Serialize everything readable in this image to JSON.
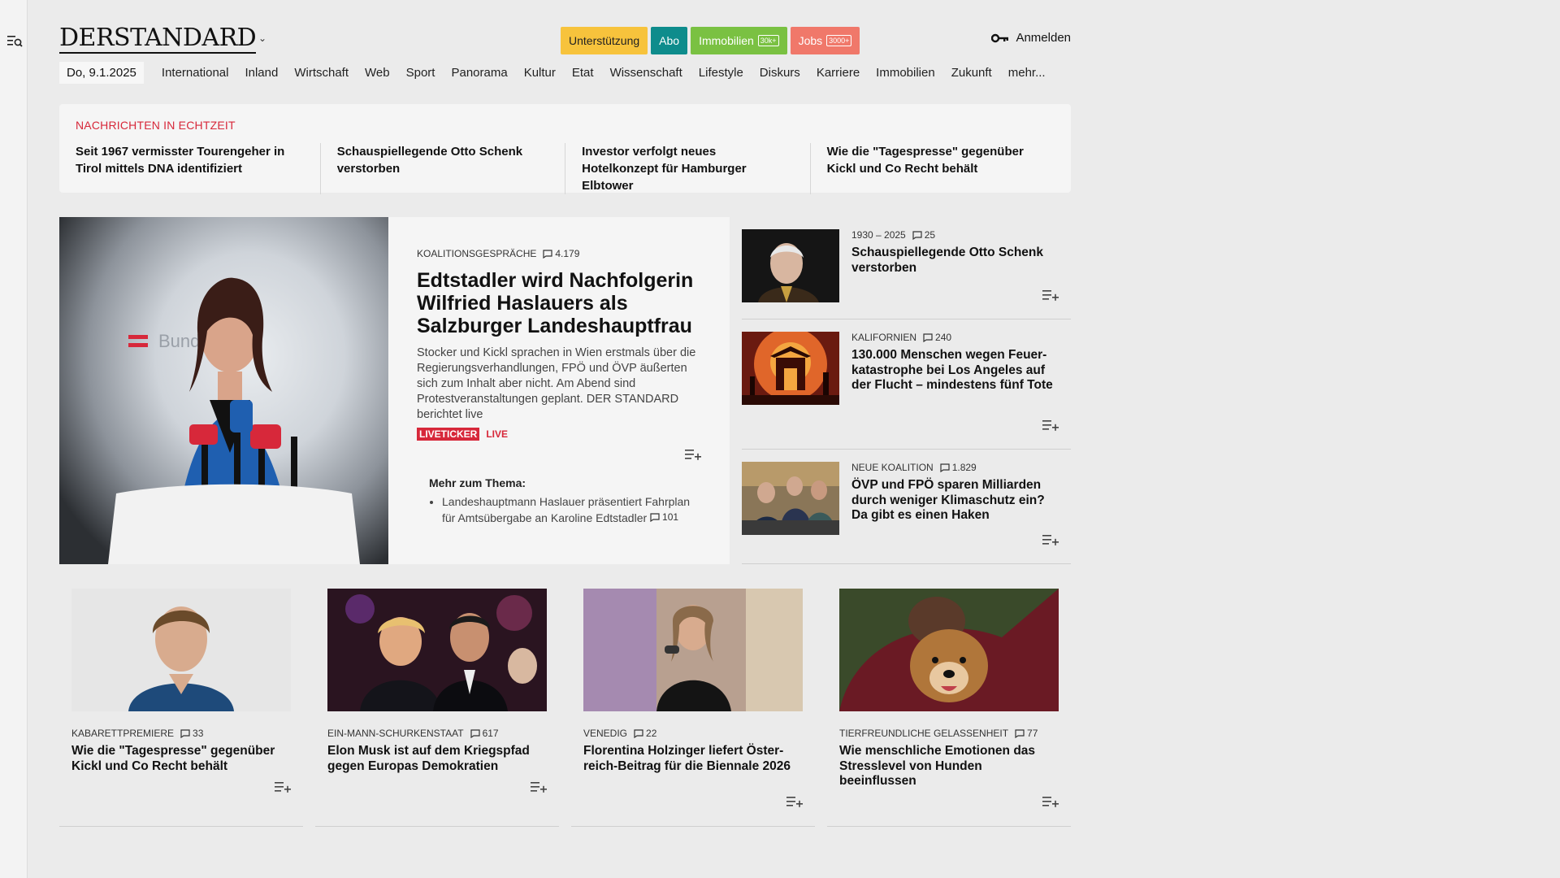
{
  "header": {
    "logo": "DERSTANDARD",
    "pills": [
      {
        "label": "Unterstützung",
        "badge": ""
      },
      {
        "label": "Abo",
        "badge": ""
      },
      {
        "label": "Immobilien",
        "badge": "30k+"
      },
      {
        "label": "Jobs",
        "badge": "3000+"
      }
    ],
    "login": "Anmelden"
  },
  "nav": {
    "date": "Do, 9.1.2025",
    "items": [
      "International",
      "Inland",
      "Wirtschaft",
      "Web",
      "Sport",
      "Panorama",
      "Kultur",
      "Etat",
      "Wissenschaft",
      "Lifestyle",
      "Diskurs",
      "Karriere",
      "Immobilien",
      "Zukunft",
      "mehr..."
    ]
  },
  "ticker": {
    "title": "Nachrichten in Echtzeit",
    "items": [
      "Seit 1967 vermisster Tourengeher in Tirol mittels DNA identifiziert",
      "Schauspiellegende Otto Schenk verstorben",
      "Investor verfolgt neues Hotelkonzept für Hamburger Elbtower",
      "Wie die \"Tagespresse\" gegenüber Kickl und Co Recht behält"
    ]
  },
  "lead": {
    "kicker": "Koalitionsgespräche",
    "comments": "4.179",
    "title": "Edtstadler wird Nachfolgerin Wilfried Haslauers als Salzburger Landeshauptfrau",
    "teaser": "Stocker und Kickl sprachen in Wien erstmals über die Regierungsverhandlungen, FPÖ und ÖVP äußerten sich zum Inhalt aber nicht. Am Abend sind Protestveranstaltungen geplant. DER STANDARD berichtet live",
    "live_tag": "LIVETICKER",
    "live_text": "LIVE",
    "more_title": "Mehr zum Thema:",
    "more_items": [
      {
        "text": "Landeshauptmann Haslauer präsentiert Fahrplan für Amtsübergabe an Karoline Edtstadler",
        "comments": "101"
      }
    ],
    "image_text": "Bundes"
  },
  "side": [
    {
      "kicker": "1930 – 2025",
      "comments": "25",
      "title": "Schauspiellegende Otto Schenk verstorben"
    },
    {
      "kicker": "Kalifornien",
      "comments": "240",
      "title": "130.000 Menschen wegen Feuer-katastrophe bei Los Angeles auf der Flucht – mindestens fünf Tote"
    },
    {
      "kicker": "Neue Koalition",
      "comments": "1.829",
      "title": "ÖVP und FPÖ sparen Milliarden durch weniger Klimaschutz ein? Da gibt es einen Haken"
    }
  ],
  "teasers": [
    {
      "kicker": "Kabarettpremiere",
      "comments": "33",
      "title": "Wie die \"Tagespresse\" gegenüber Kickl und Co Recht behält"
    },
    {
      "kicker": "Ein-Mann-Schurkenstaat",
      "comments": "617",
      "title": "Elon Musk ist auf dem Kriegspfad gegen Europas Demokratien"
    },
    {
      "kicker": "Venedig",
      "comments": "22",
      "title": "Florentina Holzinger liefert Öster-reich-Beitrag für die Biennale 2026"
    },
    {
      "kicker": "Tierfreundliche Gelassenheit",
      "comments": "77",
      "title": "Wie menschliche Emotionen das Stresslevel von Hunden beeinflussen"
    }
  ],
  "colors": {
    "accent_red": "#d7283a",
    "support": "#f7c33c",
    "abo": "#0e8c8c",
    "immo": "#7ac142",
    "jobs": "#f0786a"
  }
}
